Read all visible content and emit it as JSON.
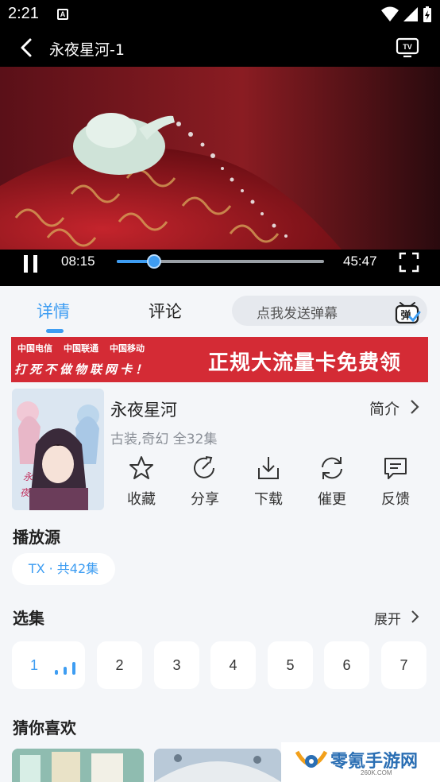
{
  "status_bar": {
    "time": "2:21",
    "a_icon": "A"
  },
  "title_bar": {
    "title": "永夜星河-1"
  },
  "player": {
    "current_time": "08:15",
    "total_time": "45:47",
    "progress": 0.18
  },
  "tabs": {
    "details": "详情",
    "comments": "评论"
  },
  "danmu": {
    "placeholder": "点我发送弹幕",
    "icon_text": "弹"
  },
  "banner": {
    "carriers": [
      "中国电信",
      "中国联通",
      "中国移动"
    ],
    "slogan": "打死不做物联网卡！",
    "headline": "正规大流量卡免费领"
  },
  "show": {
    "title": "永夜星河",
    "meta": "古装,奇幻 全32集",
    "intro_label": "简介"
  },
  "actions": [
    {
      "label": "收藏",
      "icon": "star-icon"
    },
    {
      "label": "分享",
      "icon": "share-icon"
    },
    {
      "label": "下载",
      "icon": "download-icon"
    },
    {
      "label": "催更",
      "icon": "refresh-icon"
    },
    {
      "label": "反馈",
      "icon": "feedback-icon"
    }
  ],
  "source": {
    "section_title": "播放源",
    "chip": "TX · 共42集"
  },
  "episodes": {
    "section_title": "选集",
    "expand_label": "展开",
    "items": [
      "1",
      "2",
      "3",
      "4",
      "5",
      "6",
      "7"
    ]
  },
  "recommend": {
    "section_title": "猜你喜欢"
  },
  "watermark": {
    "text": "零氪手游网",
    "sub": "260K.COM"
  },
  "colors": {
    "accent": "#3e9df2",
    "banner_red": "#d42b35"
  }
}
